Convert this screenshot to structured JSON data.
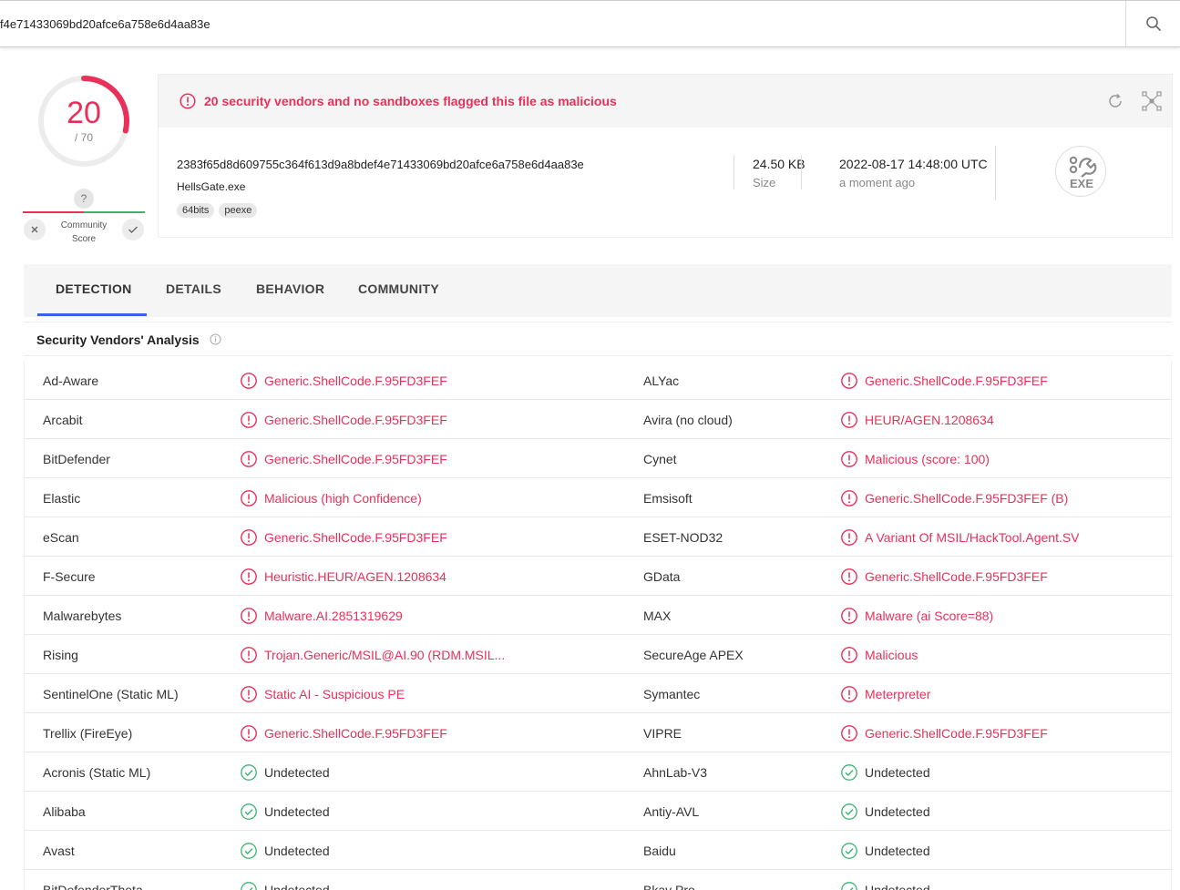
{
  "search": {
    "value": "f4e71433069bd20afce6a758e6d4aa83e"
  },
  "score": {
    "detections": "20",
    "total": "/ 70"
  },
  "community": {
    "label_line1": "Community",
    "label_line2": "Score",
    "unknown": "?"
  },
  "alert": {
    "message": "20 security vendors and no sandboxes flagged this file as malicious"
  },
  "file": {
    "sha256": "2383f65d8d609755c364f613d9a8bdef4e71433069bd20afce6a758e6d4aa83e",
    "name": "HellsGate.exe",
    "tags": [
      "64bits",
      "peexe"
    ],
    "size_value": "24.50 KB",
    "size_label": "Size",
    "date_value": "2022-08-17 14:48:00 UTC",
    "date_label": "a moment ago",
    "type_icon_label": "EXE"
  },
  "tabs": [
    "DETECTION",
    "DETAILS",
    "BEHAVIOR",
    "COMMUNITY"
  ],
  "section": {
    "title": "Security Vendors' Analysis"
  },
  "vendors": [
    [
      {
        "name": "Ad-Aware",
        "result": "Generic.ShellCode.F.95FD3FEF",
        "status": "malicious"
      },
      {
        "name": "ALYac",
        "result": "Generic.ShellCode.F.95FD3FEF",
        "status": "malicious"
      }
    ],
    [
      {
        "name": "Arcabit",
        "result": "Generic.ShellCode.F.95FD3FEF",
        "status": "malicious"
      },
      {
        "name": "Avira (no cloud)",
        "result": "HEUR/AGEN.1208634",
        "status": "malicious"
      }
    ],
    [
      {
        "name": "BitDefender",
        "result": "Generic.ShellCode.F.95FD3FEF",
        "status": "malicious"
      },
      {
        "name": "Cynet",
        "result": "Malicious (score: 100)",
        "status": "malicious"
      }
    ],
    [
      {
        "name": "Elastic",
        "result": "Malicious (high Confidence)",
        "status": "malicious"
      },
      {
        "name": "Emsisoft",
        "result": "Generic.ShellCode.F.95FD3FEF (B)",
        "status": "malicious"
      }
    ],
    [
      {
        "name": "eScan",
        "result": "Generic.ShellCode.F.95FD3FEF",
        "status": "malicious"
      },
      {
        "name": "ESET-NOD32",
        "result": "A Variant Of MSIL/HackTool.Agent.SV",
        "status": "malicious"
      }
    ],
    [
      {
        "name": "F-Secure",
        "result": "Heuristic.HEUR/AGEN.1208634",
        "status": "malicious"
      },
      {
        "name": "GData",
        "result": "Generic.ShellCode.F.95FD3FEF",
        "status": "malicious"
      }
    ],
    [
      {
        "name": "Malwarebytes",
        "result": "Malware.AI.2851319629",
        "status": "malicious"
      },
      {
        "name": "MAX",
        "result": "Malware (ai Score=88)",
        "status": "malicious"
      }
    ],
    [
      {
        "name": "Rising",
        "result": "Trojan.Generic/MSIL@AI.90 (RDM.MSIL...",
        "status": "malicious"
      },
      {
        "name": "SecureAge APEX",
        "result": "Malicious",
        "status": "malicious"
      }
    ],
    [
      {
        "name": "SentinelOne (Static ML)",
        "result": "Static AI - Suspicious PE",
        "status": "malicious"
      },
      {
        "name": "Symantec",
        "result": "Meterpreter",
        "status": "malicious"
      }
    ],
    [
      {
        "name": "Trellix (FireEye)",
        "result": "Generic.ShellCode.F.95FD3FEF",
        "status": "malicious"
      },
      {
        "name": "VIPRE",
        "result": "Generic.ShellCode.F.95FD3FEF",
        "status": "malicious"
      }
    ],
    [
      {
        "name": "Acronis (Static ML)",
        "result": "Undetected",
        "status": "undetected"
      },
      {
        "name": "AhnLab-V3",
        "result": "Undetected",
        "status": "undetected"
      }
    ],
    [
      {
        "name": "Alibaba",
        "result": "Undetected",
        "status": "undetected"
      },
      {
        "name": "Antiy-AVL",
        "result": "Undetected",
        "status": "undetected"
      }
    ],
    [
      {
        "name": "Avast",
        "result": "Undetected",
        "status": "undetected"
      },
      {
        "name": "Baidu",
        "result": "Undetected",
        "status": "undetected"
      }
    ],
    [
      {
        "name": "BitDefenderTheta",
        "result": "Undetected",
        "status": "undetected"
      },
      {
        "name": "Bkav Pro",
        "result": "Undetected",
        "status": "undetected"
      }
    ]
  ],
  "colors": {
    "malicious": "#e8305a",
    "undetected": "#3cb371",
    "tab_accent": "#3b61f0"
  },
  "icons": {
    "search": "search-icon",
    "reload": "reload-icon",
    "graph": "graph-icon",
    "malicious": "alert-circle-icon",
    "undetected": "check-circle-icon"
  }
}
